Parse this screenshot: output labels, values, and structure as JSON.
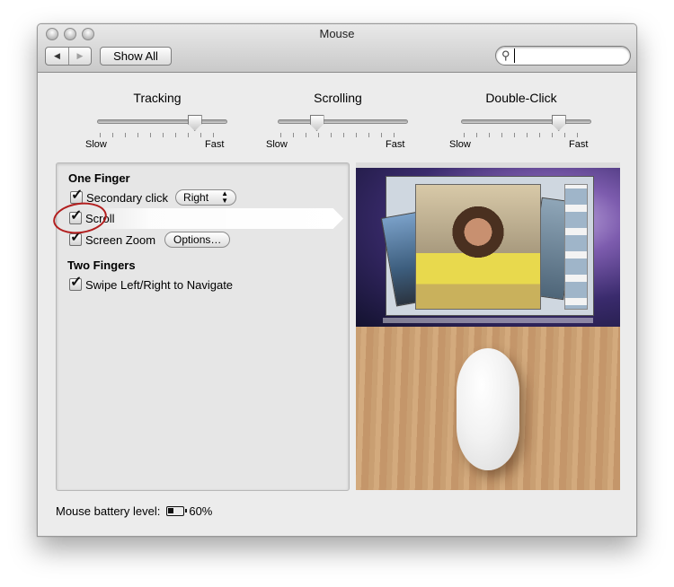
{
  "window": {
    "title": "Mouse"
  },
  "toolbar": {
    "back_label": "◀",
    "forward_label": "▶",
    "show_all_label": "Show All",
    "search_value": ""
  },
  "sliders": [
    {
      "label": "Tracking",
      "min_label": "Slow",
      "max_label": "Fast",
      "value": 0.75
    },
    {
      "label": "Scrolling",
      "min_label": "Slow",
      "max_label": "Fast",
      "value": 0.3
    },
    {
      "label": "Double-Click",
      "min_label": "Slow",
      "max_label": "Fast",
      "value": 0.75
    }
  ],
  "one_finger": {
    "heading": "One Finger",
    "secondary_click": {
      "label": "Secondary click",
      "checked": true,
      "popup_value": "Right"
    },
    "scroll": {
      "label": "Scroll",
      "checked": true
    },
    "screen_zoom": {
      "label": "Screen Zoom",
      "checked": true,
      "options_label": "Options…"
    }
  },
  "two_fingers": {
    "heading": "Two Fingers",
    "swipe": {
      "label": "Swipe Left/Right to Navigate",
      "checked": true
    }
  },
  "battery": {
    "label": "Mouse battery level:",
    "value": "60%",
    "level": 0.6
  },
  "icons": {
    "search": "magnifier-icon",
    "battery": "battery-icon",
    "check": "✓"
  },
  "colors": {
    "annotation_circle": "#b21e1e"
  }
}
